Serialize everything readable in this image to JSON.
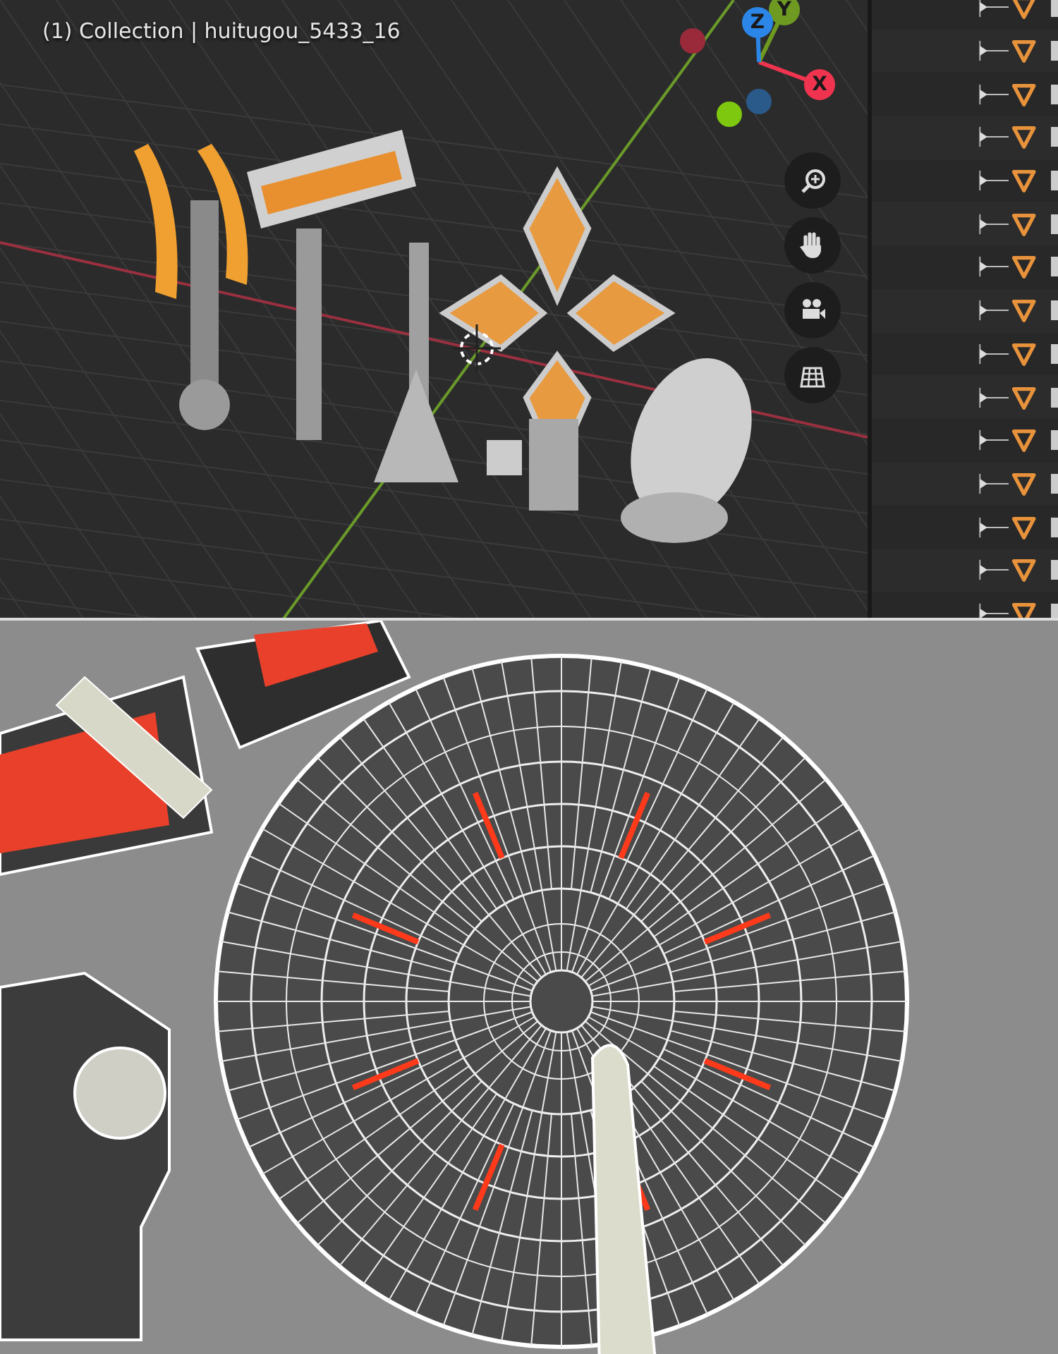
{
  "viewport": {
    "info_text": "(1) Collection | huitugou_5433_16",
    "gizmo_axes": [
      {
        "label": "X",
        "color": "#f0344f"
      },
      {
        "label": "Y",
        "color": "#6e9a22"
      },
      {
        "label": "Z",
        "color": "#2b86e8"
      }
    ]
  }
}
